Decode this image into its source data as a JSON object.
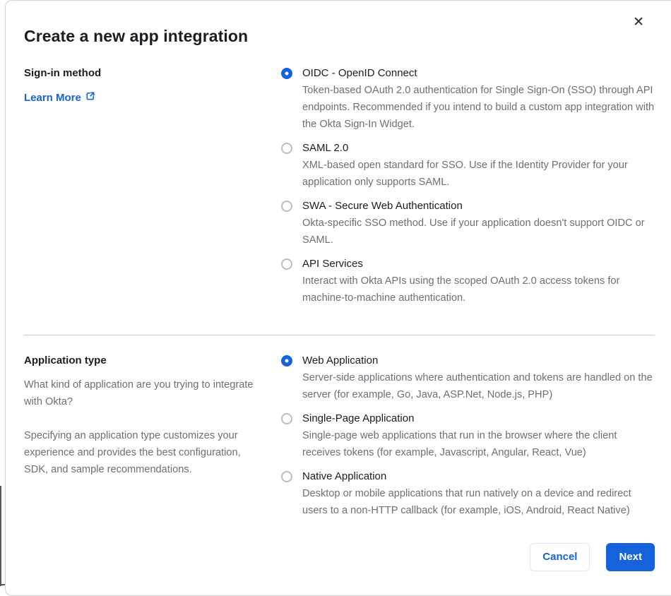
{
  "colors": {
    "accent_blue": "#1662dd",
    "text_dark": "#1d1d21",
    "text_muted": "#6e6e78",
    "divider": "#cbcbd1"
  },
  "icons": {
    "close_glyph": "✕",
    "external_link": "box-with-arrow-top-right"
  },
  "modal": {
    "title": "Create a new app integration"
  },
  "signin": {
    "heading": "Sign-in method",
    "learn_more_label": "Learn More",
    "options": [
      {
        "label": "OIDC - OpenID Connect",
        "description": "Token-based OAuth 2.0 authentication for Single Sign-On (SSO) through API endpoints. Recommended if you intend to build a custom app integration with the Okta Sign-In Widget.",
        "selected": true
      },
      {
        "label": "SAML 2.0",
        "description": "XML-based open standard for SSO. Use if the Identity Provider for your application only supports SAML.",
        "selected": false
      },
      {
        "label": "SWA - Secure Web Authentication",
        "description": "Okta-specific SSO method. Use if your application doesn't support OIDC or SAML.",
        "selected": false
      },
      {
        "label": "API Services",
        "description": "Interact with Okta APIs using the scoped OAuth 2.0 access tokens for machine-to-machine authentication.",
        "selected": false
      }
    ]
  },
  "apptype": {
    "heading": "Application type",
    "paragraph1": "What kind of application are you trying to integrate with Okta?",
    "paragraph2": "Specifying an application type customizes your experience and provides the best configuration, SDK, and sample recommendations.",
    "options": [
      {
        "label": "Web Application",
        "description": "Server-side applications where authentication and tokens are handled on the server (for example, Go, Java, ASP.Net, Node.js, PHP)",
        "selected": true
      },
      {
        "label": "Single-Page Application",
        "description": "Single-page web applications that run in the browser where the client receives tokens (for example, Javascript, Angular, React, Vue)",
        "selected": false
      },
      {
        "label": "Native Application",
        "description": "Desktop or mobile applications that run natively on a device and redirect users to a non-HTTP callback (for example, iOS, Android, React Native)",
        "selected": false
      }
    ]
  },
  "footer": {
    "cancel_label": "Cancel",
    "next_label": "Next"
  }
}
